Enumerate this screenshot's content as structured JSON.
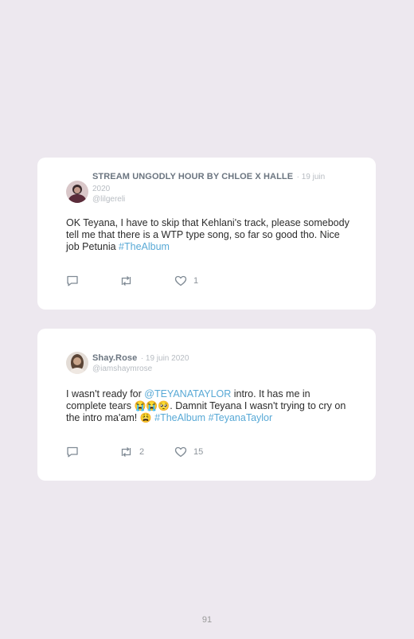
{
  "tweets": [
    {
      "name": "STREAM UNGODLY HOUR BY CHLOE X HALLE",
      "date": "· 19 juin 2020",
      "handle": "@lilgereli",
      "text": [
        {
          "t": "OK Teyana, I have to skip that Kehlani's track, please somebody tell me that there is a WTP type song, so far so good tho. Nice job Petunia "
        },
        {
          "link": "#TheAlbum"
        }
      ],
      "retweets": "",
      "likes": "1"
    },
    {
      "name": "Shay.Rose",
      "date": "· 19 juin 2020",
      "handle": "@iamshaymrose",
      "text": [
        {
          "t": "I wasn't ready for "
        },
        {
          "link": "@TEYANATAYLOR"
        },
        {
          "t": " intro. It has me in complete tears "
        },
        {
          "emoji": "😭😭🥺"
        },
        {
          "t": ". Damnit Teyana I wasn't trying to cry on the intro ma'am! "
        },
        {
          "emoji": "😩"
        },
        {
          "t": " "
        },
        {
          "link": "#TheAlbum"
        },
        {
          "t": " "
        },
        {
          "link": "#TeyanaTaylor"
        }
      ],
      "retweets": "2",
      "likes": "15"
    }
  ],
  "page_number": "91",
  "colors": {
    "background": "#ede8ef",
    "card": "#ffffff",
    "link": "#58a9d6",
    "name": "#6b7580",
    "meta": "#b7bcc2"
  },
  "icons": [
    "reply-icon",
    "retweet-icon",
    "like-icon"
  ]
}
